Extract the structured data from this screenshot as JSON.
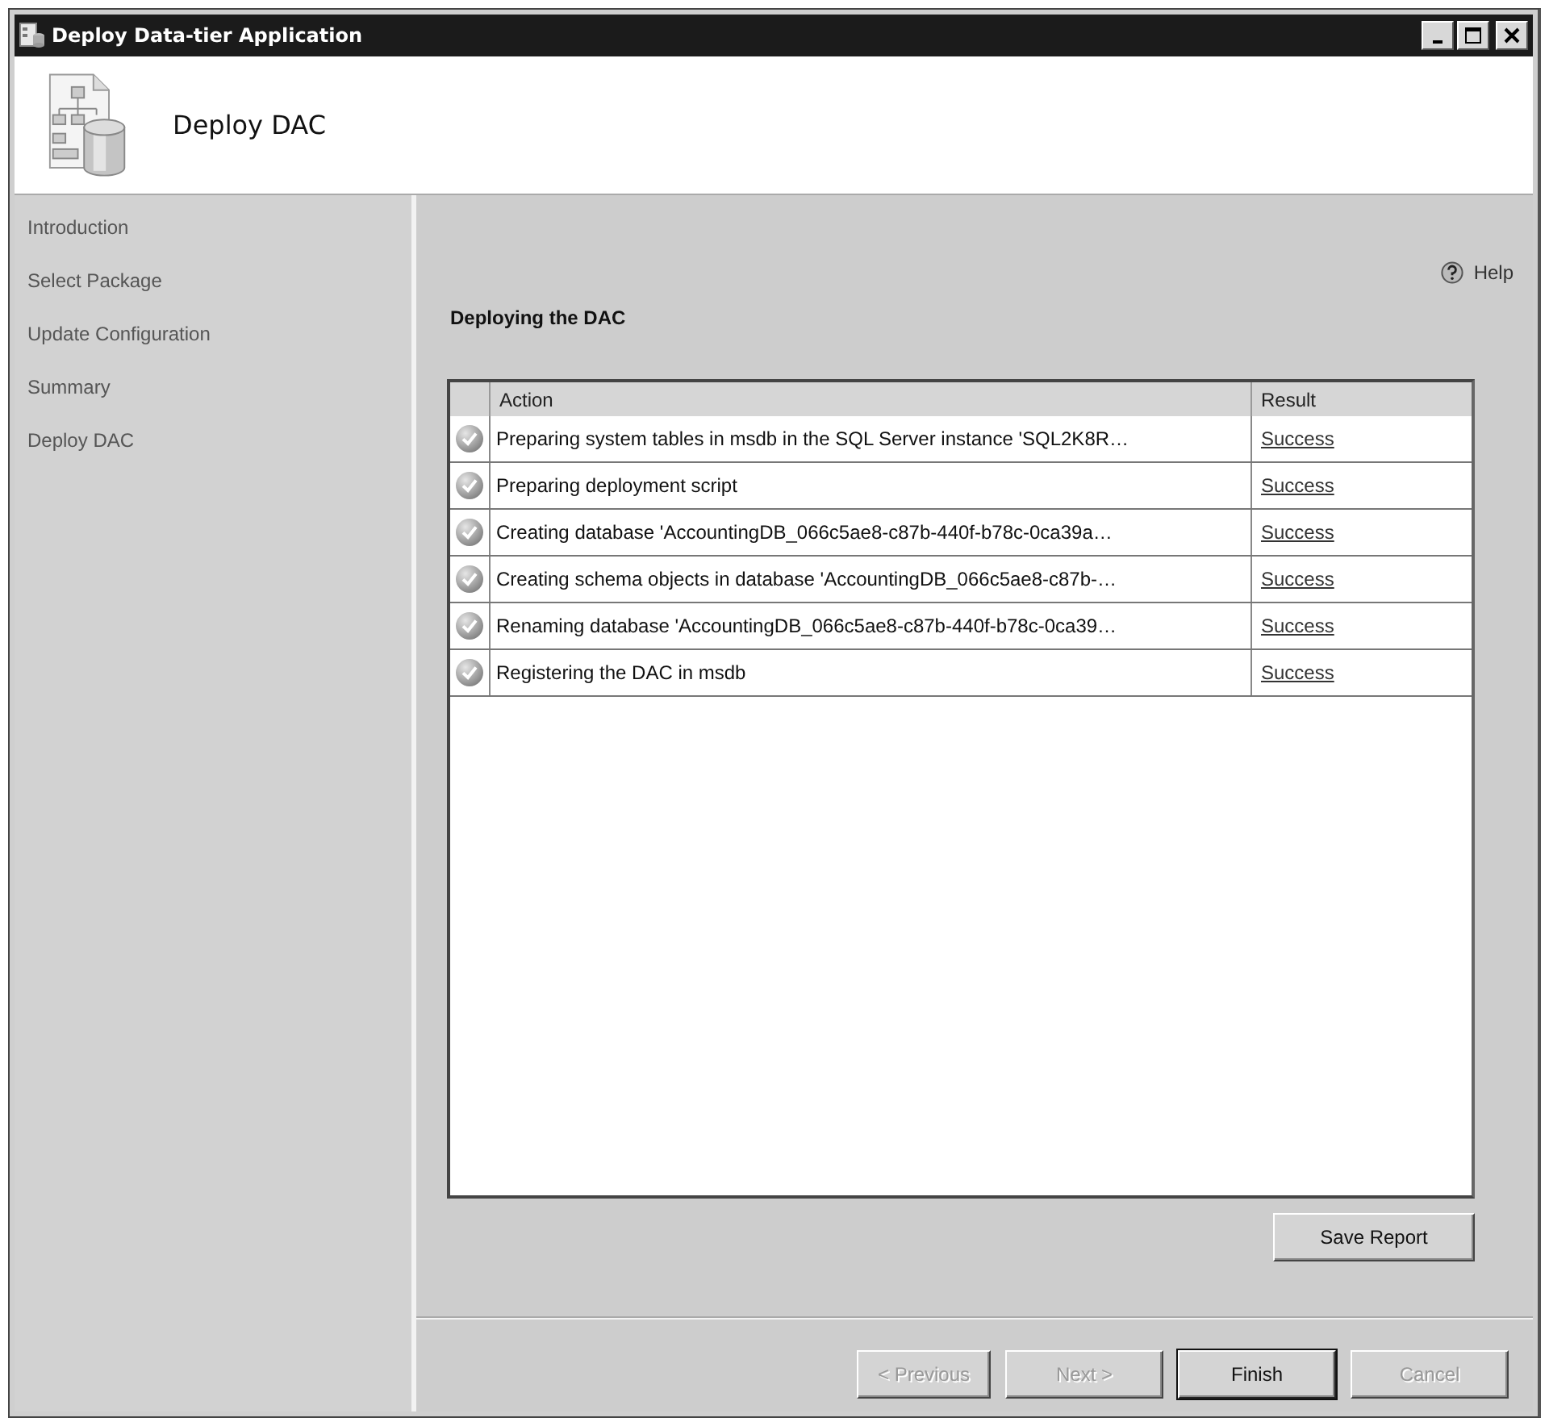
{
  "window": {
    "title": "Deploy Data-tier Application"
  },
  "header": {
    "title": "Deploy DAC"
  },
  "sidebar": {
    "items": [
      {
        "label": "Introduction"
      },
      {
        "label": "Select Package"
      },
      {
        "label": "Update Configuration"
      },
      {
        "label": "Summary"
      },
      {
        "label": "Deploy DAC"
      }
    ]
  },
  "help": {
    "label": "Help"
  },
  "heading": "Deploying the DAC",
  "table": {
    "columns": [
      "Action",
      "Result"
    ],
    "rows": [
      {
        "action": "Preparing system tables in msdb in the SQL Server instance 'SQL2K8R…",
        "result": "Success"
      },
      {
        "action": "Preparing deployment script",
        "result": "Success"
      },
      {
        "action": "Creating database 'AccountingDB_066c5ae8-c87b-440f-b78c-0ca39a…",
        "result": "Success"
      },
      {
        "action": "Creating schema objects in database 'AccountingDB_066c5ae8-c87b-…",
        "result": "Success"
      },
      {
        "action": "Renaming database 'AccountingDB_066c5ae8-c87b-440f-b78c-0ca39…",
        "result": "Success"
      },
      {
        "action": "Registering the DAC in msdb",
        "result": "Success"
      }
    ]
  },
  "save_report": {
    "label": "Save Report"
  },
  "buttons": [
    {
      "label": "< Previous",
      "disabled": true,
      "default": false
    },
    {
      "label": "Next >",
      "disabled": true,
      "default": false
    },
    {
      "label": "Finish",
      "disabled": false,
      "default": true
    },
    {
      "label": "Cancel",
      "disabled": true,
      "default": false
    }
  ]
}
